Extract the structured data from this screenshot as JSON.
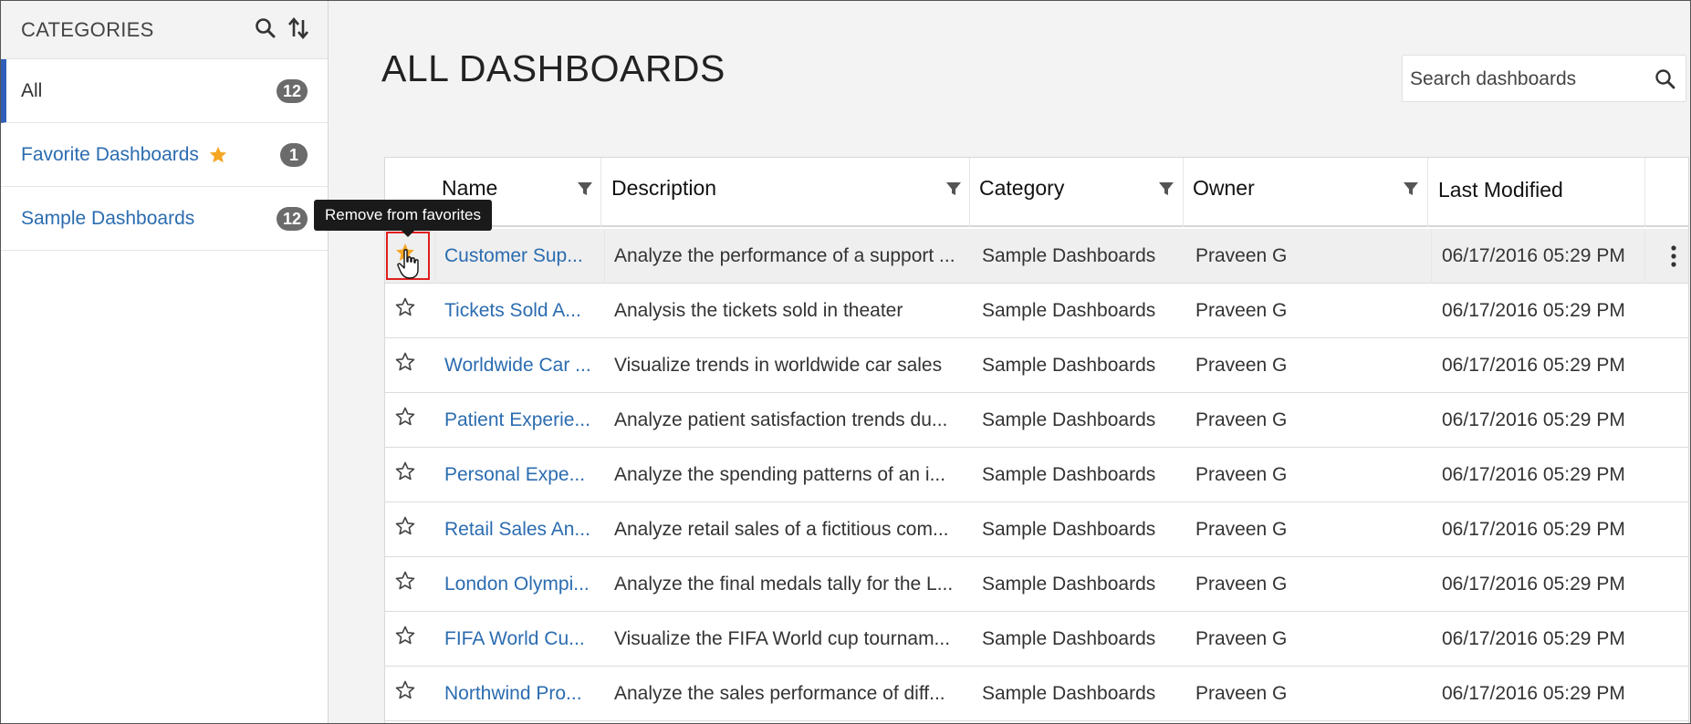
{
  "sidebar": {
    "title": "CATEGORIES",
    "items": [
      {
        "label": "All",
        "count": "12"
      },
      {
        "label": "Favorite Dashboards",
        "count": "1"
      },
      {
        "label": "Sample Dashboards",
        "count": "12"
      }
    ]
  },
  "main": {
    "title": "ALL DASHBOARDS",
    "search_placeholder": "Search dashboards"
  },
  "table": {
    "columns": [
      "Name",
      "Description",
      "Category",
      "Owner",
      "Last Modified"
    ],
    "rows": [
      {
        "name": "Customer Sup...",
        "description": "Analyze the performance of a support ...",
        "category": "Sample Dashboards",
        "owner": "Praveen G",
        "modified": "06/17/2016 05:29 PM",
        "favorite": true
      },
      {
        "name": "Tickets Sold A...",
        "description": "Analysis the tickets sold in theater",
        "category": "Sample Dashboards",
        "owner": "Praveen G",
        "modified": "06/17/2016 05:29 PM",
        "favorite": false
      },
      {
        "name": "Worldwide Car ...",
        "description": "Visualize trends in worldwide car sales",
        "category": "Sample Dashboards",
        "owner": "Praveen G",
        "modified": "06/17/2016 05:29 PM",
        "favorite": false
      },
      {
        "name": "Patient Experie...",
        "description": "Analyze patient satisfaction trends du...",
        "category": "Sample Dashboards",
        "owner": "Praveen G",
        "modified": "06/17/2016 05:29 PM",
        "favorite": false
      },
      {
        "name": "Personal Expe...",
        "description": "Analyze the spending patterns of an i...",
        "category": "Sample Dashboards",
        "owner": "Praveen G",
        "modified": "06/17/2016 05:29 PM",
        "favorite": false
      },
      {
        "name": "Retail Sales An...",
        "description": "Analyze retail sales of a fictitious com...",
        "category": "Sample Dashboards",
        "owner": "Praveen G",
        "modified": "06/17/2016 05:29 PM",
        "favorite": false
      },
      {
        "name": "London Olympi...",
        "description": "Analyze the final medals tally for the L...",
        "category": "Sample Dashboards",
        "owner": "Praveen G",
        "modified": "06/17/2016 05:29 PM",
        "favorite": false
      },
      {
        "name": "FIFA World Cu...",
        "description": "Visualize the FIFA World cup tournam...",
        "category": "Sample Dashboards",
        "owner": "Praveen G",
        "modified": "06/17/2016 05:29 PM",
        "favorite": false
      },
      {
        "name": "Northwind Pro...",
        "description": "Analyze the sales performance of diff...",
        "category": "Sample Dashboards",
        "owner": "Praveen G",
        "modified": "06/17/2016 05:29 PM",
        "favorite": false
      }
    ]
  },
  "tooltip": {
    "text": "Remove from favorites"
  },
  "colors": {
    "accent": "#2f5fb8",
    "link": "#2b6cb0",
    "star_filled": "#f5a623",
    "badge": "#6b6b6b",
    "highlight_box": "#e01e1e"
  },
  "icons": {
    "sidebar_search": "search-icon",
    "sidebar_sort": "sort-icon",
    "favorite": "star-icon",
    "column_filter": "filter-icon",
    "row_menu": "more-vertical-icon",
    "search": "search-icon"
  }
}
